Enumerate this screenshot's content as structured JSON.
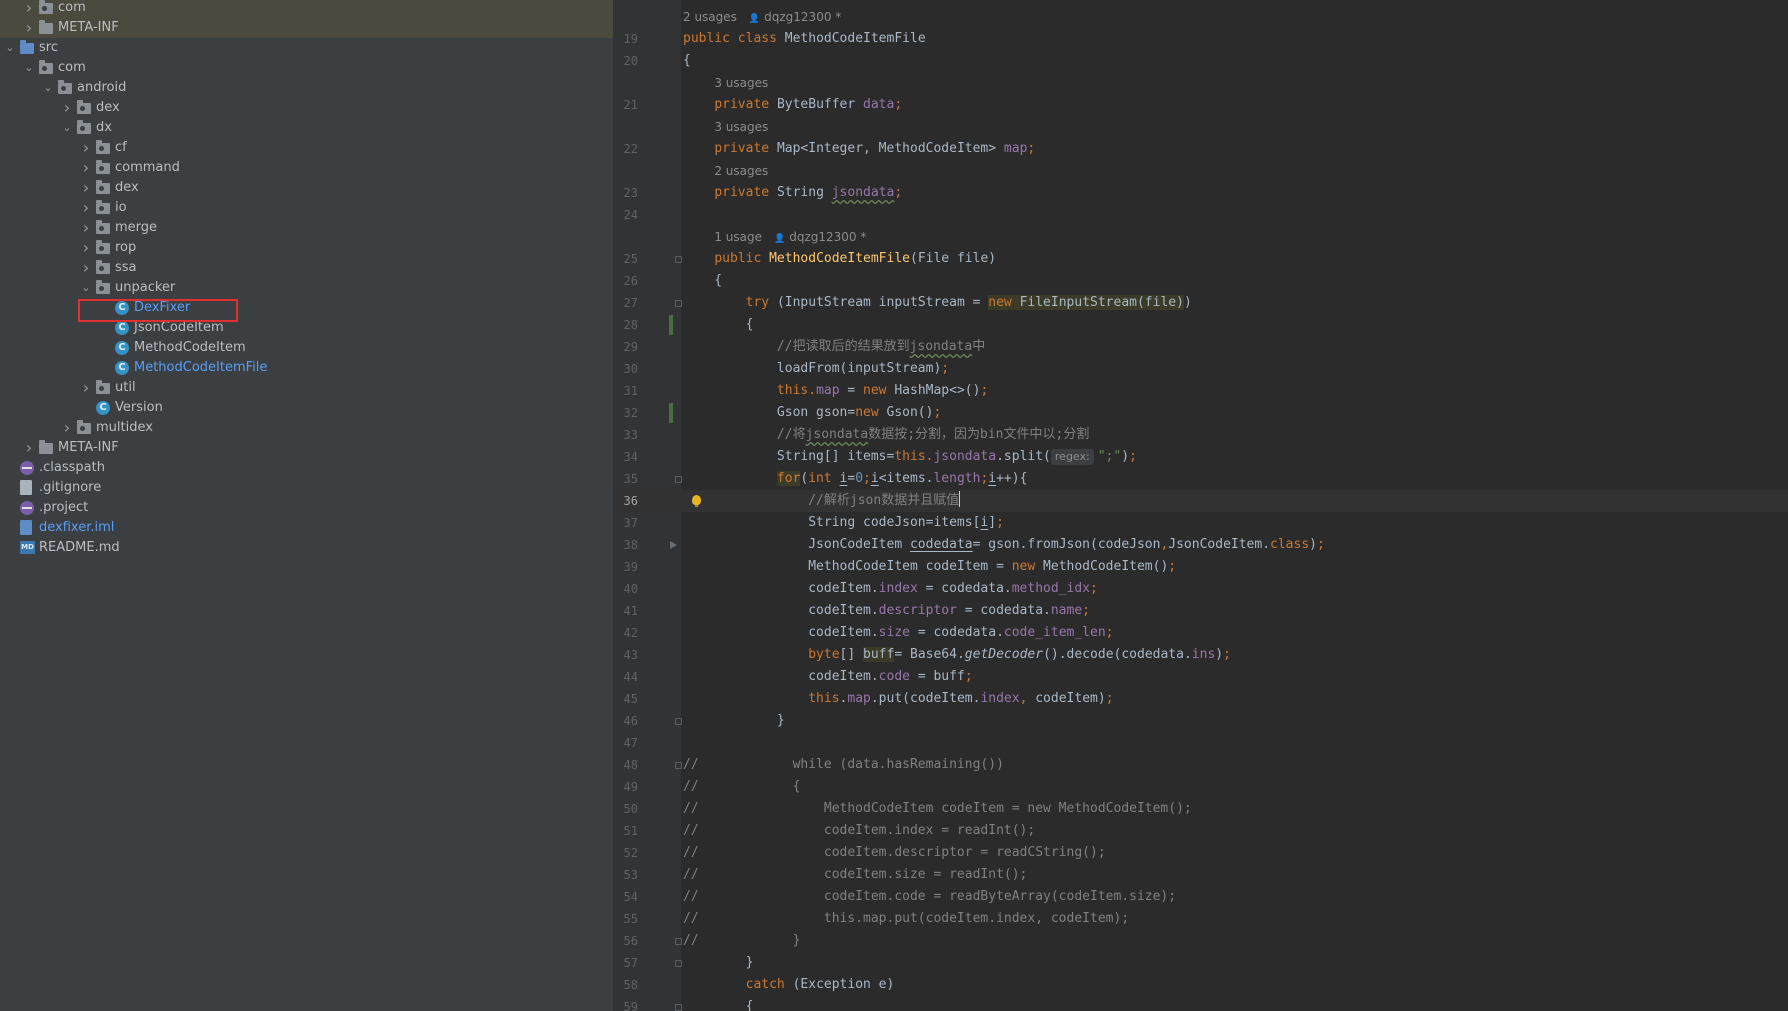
{
  "tree": {
    "items": [
      {
        "label": "com",
        "depth": 1,
        "kind": "package",
        "expanded": false
      },
      {
        "label": "META-INF",
        "depth": 1,
        "kind": "folder",
        "expanded": false
      },
      {
        "label": "src",
        "depth": 0,
        "kind": "source-folder",
        "expanded": true
      },
      {
        "label": "com",
        "depth": 1,
        "kind": "package",
        "expanded": true
      },
      {
        "label": "android",
        "depth": 2,
        "kind": "package",
        "expanded": true
      },
      {
        "label": "dex",
        "depth": 3,
        "kind": "package",
        "expanded": false
      },
      {
        "label": "dx",
        "depth": 3,
        "kind": "package",
        "expanded": true
      },
      {
        "label": "cf",
        "depth": 4,
        "kind": "package",
        "expanded": false
      },
      {
        "label": "command",
        "depth": 4,
        "kind": "package",
        "expanded": false
      },
      {
        "label": "dex",
        "depth": 4,
        "kind": "package",
        "expanded": false
      },
      {
        "label": "io",
        "depth": 4,
        "kind": "package",
        "expanded": false
      },
      {
        "label": "merge",
        "depth": 4,
        "kind": "package",
        "expanded": false
      },
      {
        "label": "rop",
        "depth": 4,
        "kind": "package",
        "expanded": false
      },
      {
        "label": "ssa",
        "depth": 4,
        "kind": "package",
        "expanded": false
      },
      {
        "label": "unpacker",
        "depth": 4,
        "kind": "package",
        "expanded": true
      },
      {
        "label": "DexFixer",
        "depth": 5,
        "kind": "class",
        "color": "blue"
      },
      {
        "label": "JsonCodeItem",
        "depth": 5,
        "kind": "class"
      },
      {
        "label": "MethodCodeItem",
        "depth": 5,
        "kind": "class"
      },
      {
        "label": "MethodCodeItemFile",
        "depth": 5,
        "kind": "class",
        "color": "blue"
      },
      {
        "label": "util",
        "depth": 4,
        "kind": "package",
        "expanded": false
      },
      {
        "label": "Version",
        "depth": 4,
        "kind": "class"
      },
      {
        "label": "multidex",
        "depth": 3,
        "kind": "package",
        "expanded": false
      },
      {
        "label": "META-INF",
        "depth": 1,
        "kind": "folder",
        "expanded": false
      },
      {
        "label": ".classpath",
        "depth": 0,
        "kind": "config"
      },
      {
        "label": ".gitignore",
        "depth": 0,
        "kind": "text"
      },
      {
        "label": ".project",
        "depth": 0,
        "kind": "config"
      },
      {
        "label": "dexfixer.iml",
        "depth": 0,
        "kind": "iml",
        "color": "blue"
      },
      {
        "label": "README.md",
        "depth": 0,
        "kind": "md"
      }
    ],
    "icons": {
      "md_badge": "MD",
      "class_badge": "C"
    }
  },
  "editor": {
    "current_line": "36",
    "lines": [
      {
        "hint": "2 usages",
        "author": "dqzg12300 *",
        "indent": 0
      },
      {
        "n": "19",
        "tokens": [
          [
            "kw",
            "public "
          ],
          [
            "kw",
            "class "
          ],
          [
            "",
            "MethodCodeItemFile"
          ]
        ]
      },
      {
        "n": "20",
        "tokens": [
          [
            "",
            "{"
          ]
        ]
      },
      {
        "hint": "3 usages",
        "indent": 4
      },
      {
        "n": "21",
        "tokens": [
          [
            "",
            "    "
          ],
          [
            "kw",
            "private "
          ],
          [
            "",
            "ByteBuffer "
          ],
          [
            "fld",
            "data"
          ],
          [
            "kw",
            ";"
          ]
        ]
      },
      {
        "hint": "3 usages",
        "indent": 4
      },
      {
        "n": "22",
        "tokens": [
          [
            "",
            "    "
          ],
          [
            "kw",
            "private "
          ],
          [
            "",
            "Map<Integer, MethodCodeItem> "
          ],
          [
            "fld",
            "map"
          ],
          [
            "kw",
            ";"
          ]
        ]
      },
      {
        "hint": "2 usages",
        "indent": 4
      },
      {
        "n": "23",
        "tokens": [
          [
            "",
            "    "
          ],
          [
            "kw",
            "private "
          ],
          [
            "",
            "String "
          ],
          [
            "fld wavy",
            "jsondata"
          ],
          [
            "kw",
            ";"
          ]
        ]
      },
      {
        "n": "24",
        "tokens": []
      },
      {
        "hint": "1 usage",
        "author": "dqzg12300 *",
        "indent": 4
      },
      {
        "n": "25",
        "tokens": [
          [
            "",
            "    "
          ],
          [
            "kw",
            "public "
          ],
          [
            "fn",
            "MethodCodeItemFile"
          ],
          [
            "",
            "(File file)"
          ]
        ],
        "fold": true
      },
      {
        "n": "26",
        "tokens": [
          [
            "",
            "    {"
          ]
        ]
      },
      {
        "n": "27",
        "tokens": [
          [
            "",
            "        "
          ],
          [
            "kw",
            "try "
          ],
          [
            "",
            "(InputStream inputStream = "
          ],
          [
            "kw hlbg",
            "new "
          ],
          [
            "hlbg",
            "FileInputStream(file)"
          ],
          [
            "",
            ")"
          ]
        ],
        "fold": true
      },
      {
        "n": "28",
        "tokens": [
          [
            "",
            "        {"
          ]
        ],
        "change": true
      },
      {
        "n": "29",
        "tokens": [
          [
            "",
            "            "
          ],
          [
            "cmt",
            "//把读取后的结果放到"
          ],
          [
            "cmt wavy",
            "jsondata"
          ],
          [
            "cmt",
            "中"
          ]
        ]
      },
      {
        "n": "30",
        "tokens": [
          [
            "",
            "            loadFrom(inputStream)"
          ],
          [
            "kw",
            ";"
          ]
        ]
      },
      {
        "n": "31",
        "tokens": [
          [
            "",
            "            "
          ],
          [
            "kw",
            "this"
          ],
          [
            "",
            ""
          ],
          [
            "kw",
            "."
          ],
          [
            "fld",
            "map "
          ],
          [
            "",
            "= "
          ],
          [
            "kw",
            "new "
          ],
          [
            "",
            "HashMap<>()"
          ],
          [
            "kw",
            ";"
          ]
        ]
      },
      {
        "n": "32",
        "tokens": [
          [
            "",
            "            Gson gson="
          ],
          [
            "kw",
            "new "
          ],
          [
            "",
            "Gson()"
          ],
          [
            "kw",
            ";"
          ]
        ],
        "change": true
      },
      {
        "n": "33",
        "tokens": [
          [
            "",
            "            "
          ],
          [
            "cmt",
            "//将"
          ],
          [
            "cmt wavy",
            "jsondata"
          ],
          [
            "cmt",
            "数据按;分割，因为bin文件中以;分割"
          ]
        ]
      },
      {
        "n": "34",
        "tokens": [
          [
            "",
            "            String[] items="
          ],
          [
            "kw",
            "this."
          ],
          [
            "fld",
            "jsondata"
          ],
          [
            "",
            ".split("
          ],
          [
            "param",
            "regex:"
          ],
          [
            "str",
            "\";\""
          ],
          [
            "",
            ")"
          ],
          [
            "kw",
            ";"
          ]
        ]
      },
      {
        "n": "35",
        "tokens": [
          [
            "",
            "            "
          ],
          [
            "kw hlbg",
            "for"
          ],
          [
            "",
            "("
          ],
          [
            "kw",
            "int "
          ],
          [
            "under",
            "i"
          ],
          [
            "",
            "="
          ],
          [
            "num",
            "0"
          ],
          [
            "kw",
            ";"
          ],
          [
            "under",
            "i"
          ],
          [
            "",
            "<items."
          ],
          [
            "fld",
            "length"
          ],
          [
            "kw",
            ";"
          ],
          [
            "under",
            "i"
          ],
          [
            "",
            "++){"
          ]
        ],
        "fold": true
      },
      {
        "n": "36",
        "tokens": [
          [
            "",
            "                "
          ],
          [
            "cmt",
            "//解析json数据并且赋值"
          ],
          [
            "caret",
            ""
          ]
        ],
        "bulb": true
      },
      {
        "n": "37",
        "tokens": [
          [
            "",
            "                String codeJson=items["
          ],
          [
            "under",
            "i"
          ],
          [
            "",
            "]"
          ],
          [
            "kw",
            ";"
          ]
        ]
      },
      {
        "n": "38",
        "tokens": [
          [
            "",
            "                JsonCodeItem "
          ],
          [
            "under",
            "codedata"
          ],
          [
            "",
            "= gson.fromJson(codeJson"
          ],
          [
            "kw",
            ","
          ],
          [
            "",
            "JsonCodeItem."
          ],
          [
            "kw",
            "class"
          ],
          [
            "",
            ")"
          ],
          [
            "kw",
            ";"
          ]
        ],
        "play": true
      },
      {
        "n": "39",
        "tokens": [
          [
            "",
            "                MethodCodeItem codeItem = "
          ],
          [
            "kw",
            "new "
          ],
          [
            "",
            "MethodCodeItem()"
          ],
          [
            "kw",
            ";"
          ]
        ]
      },
      {
        "n": "40",
        "tokens": [
          [
            "",
            "                codeItem."
          ],
          [
            "fld",
            "index "
          ],
          [
            "",
            "= codedata."
          ],
          [
            "fld",
            "method_idx"
          ],
          [
            "kw",
            ";"
          ]
        ]
      },
      {
        "n": "41",
        "tokens": [
          [
            "",
            "                codeItem."
          ],
          [
            "fld",
            "descriptor "
          ],
          [
            "",
            "= codedata."
          ],
          [
            "fld",
            "name"
          ],
          [
            "kw",
            ";"
          ]
        ]
      },
      {
        "n": "42",
        "tokens": [
          [
            "",
            "                codeItem."
          ],
          [
            "fld",
            "size "
          ],
          [
            "",
            "= codedata."
          ],
          [
            "fld",
            "code_item_len"
          ],
          [
            "kw",
            ";"
          ]
        ]
      },
      {
        "n": "43",
        "tokens": [
          [
            "",
            "                "
          ],
          [
            "kw",
            "byte"
          ],
          [
            "",
            "[] "
          ],
          [
            "hlbg",
            "buff"
          ],
          [
            "",
            "= Base64."
          ],
          [
            "italic",
            "getDecoder"
          ],
          [
            "",
            "().decode(codedata."
          ],
          [
            "fld",
            "ins"
          ],
          [
            "",
            ")"
          ],
          [
            "kw",
            ";"
          ]
        ]
      },
      {
        "n": "44",
        "tokens": [
          [
            "",
            "                codeItem."
          ],
          [
            "fld",
            "code "
          ],
          [
            "",
            "= buff"
          ],
          [
            "kw",
            ";"
          ]
        ]
      },
      {
        "n": "45",
        "tokens": [
          [
            "",
            "                "
          ],
          [
            "kw",
            "this"
          ],
          [
            "",
            "."
          ],
          [
            "fld",
            "map"
          ],
          [
            "",
            ".put(codeItem."
          ],
          [
            "fld",
            "index"
          ],
          [
            "kw",
            ", "
          ],
          [
            "",
            "codeItem)"
          ],
          [
            "kw",
            ";"
          ]
        ]
      },
      {
        "n": "46",
        "tokens": [
          [
            "",
            "            }"
          ]
        ],
        "fold": true
      },
      {
        "n": "47",
        "tokens": []
      },
      {
        "n": "48",
        "tokens": [
          [
            "cmt",
            "//            while (data.hasRemaining())"
          ]
        ],
        "fold": true
      },
      {
        "n": "49",
        "tokens": [
          [
            "cmt",
            "//            {"
          ]
        ]
      },
      {
        "n": "50",
        "tokens": [
          [
            "cmt",
            "//                MethodCodeItem codeItem = new MethodCodeItem();"
          ]
        ]
      },
      {
        "n": "51",
        "tokens": [
          [
            "cmt",
            "//                codeItem.index = readInt();"
          ]
        ]
      },
      {
        "n": "52",
        "tokens": [
          [
            "cmt",
            "//                codeItem.descriptor = readCString();"
          ]
        ]
      },
      {
        "n": "53",
        "tokens": [
          [
            "cmt",
            "//                codeItem.size = readInt();"
          ]
        ]
      },
      {
        "n": "54",
        "tokens": [
          [
            "cmt",
            "//                codeItem.code = readByteArray(codeItem.size);"
          ]
        ]
      },
      {
        "n": "55",
        "tokens": [
          [
            "cmt",
            "//                this.map.put(codeItem.index, codeItem);"
          ]
        ]
      },
      {
        "n": "56",
        "tokens": [
          [
            "cmt",
            "//            }"
          ]
        ],
        "fold": true
      },
      {
        "n": "57",
        "tokens": [
          [
            "",
            "        }"
          ]
        ],
        "fold": true
      },
      {
        "n": "58",
        "tokens": [
          [
            "",
            "        "
          ],
          [
            "kw",
            "catch "
          ],
          [
            "",
            "(Exception e)"
          ]
        ]
      },
      {
        "n": "59",
        "tokens": [
          [
            "",
            "        {"
          ]
        ],
        "fold": true
      }
    ]
  },
  "colors": {
    "tree_bg": "#3c3f41",
    "editor_bg": "#2b2b2b",
    "keyword": "#cc7832",
    "field": "#9876aa",
    "method": "#ffc66d",
    "comment": "#808080",
    "string": "#6a8759",
    "number": "#6897bb",
    "selection_box": "#e03030",
    "link_blue": "#589df6"
  }
}
